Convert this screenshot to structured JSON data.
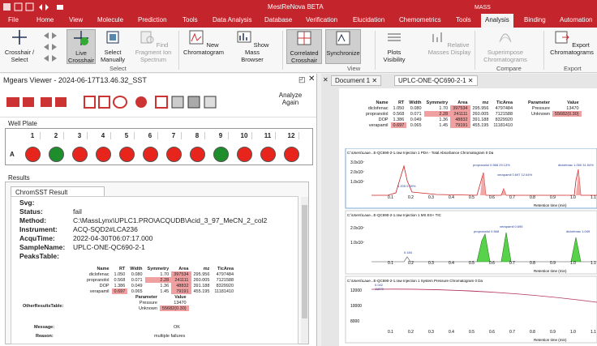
{
  "app": {
    "title": "MestReNova BETA",
    "context_tab": "MASS"
  },
  "menu": [
    "File",
    "Home",
    "View",
    "Molecule",
    "Prediction",
    "Tools",
    "Data Analysis",
    "Database",
    "Verification",
    "Elucidation",
    "Chemometrics",
    "Tools",
    "Analysis",
    "Binding",
    "Automation"
  ],
  "ribbon": {
    "buttons": [
      "Crosshair / Select",
      "Live Crosshair",
      "Select Manually",
      "Find Fragment Ion Spectrum",
      "New Chromatogram",
      "Show Mass Browser",
      "Correlated Crosshair",
      "Synchronize",
      "Plots Visibility",
      "Relative Masses Display",
      "Superimpose Chromatograms",
      "Export Chromatograms"
    ],
    "groups": [
      "Select",
      "View",
      "Compare",
      "Export"
    ]
  },
  "viewer": {
    "title": "Mgears Viewer - 2024-06-17T13.46.32_SST",
    "analyze_again": "Analyze Again",
    "well_plate_label": "Well Plate",
    "results_label": "Results",
    "result_tab": "ChromSST Result"
  },
  "plate": {
    "row": "A",
    "cols": [
      "1",
      "2",
      "3",
      "4",
      "5",
      "6",
      "7",
      "8",
      "9",
      "10",
      "11",
      "12"
    ],
    "wells": [
      "red",
      "green",
      "red",
      "red",
      "red",
      "red",
      "red",
      "red",
      "green",
      "red",
      "red",
      "red"
    ]
  },
  "result": {
    "labels": [
      "Svg:",
      "Status:",
      "Method:",
      "Instrument:",
      "AcquTime:",
      "SampleName:",
      "PeaksTable:"
    ],
    "values": [
      "",
      "fail",
      "C:\\MassLynx\\UPLC1.PRO\\ACQUDB\\Acid_3_97_MeCN_2_col2",
      "ACQ-SQD2#LCA236",
      "2022-04-30T06:07:17.000",
      "UPLC-ONE-QC690-2-1",
      ""
    ],
    "other_label": "OtherResultsTable:",
    "message_label": "Message:",
    "message": "OK",
    "reason_label": "Reason:",
    "reason": "multiple failures"
  },
  "peaks_table": {
    "headers": [
      "Name",
      "RT",
      "Width",
      "Symmetry",
      "Area",
      "mz",
      "TicArea"
    ],
    "rows": [
      [
        "diclofenac",
        "1.050",
        "0.080",
        "1.70",
        "397534",
        "295.956",
        "4797484"
      ],
      [
        "propranolol",
        "0.568",
        "0.071",
        "2.28",
        "241111",
        "260.005",
        "7121588"
      ],
      [
        "DOP",
        "1.386",
        "0.049",
        "1.36",
        "48832",
        "391.188",
        "8329920"
      ],
      [
        "verapamil",
        "0.697",
        "0.065",
        "1.45",
        "79191",
        "455.195",
        "11181410"
      ]
    ]
  },
  "other_table": {
    "headers": [
      "Parameter",
      "Value"
    ],
    "rows": [
      [
        "Pressure",
        "13470"
      ],
      [
        "Unknown",
        "55682(0.30)"
      ]
    ]
  },
  "documents": {
    "tab1": "Document 1",
    "tab2": "UPLC-ONE-QC690-2-1"
  },
  "plots": [
    {
      "title": "C:\\Users\\Laue...E-QC690-2-1.raw Injection 1 PDA - Total Absorbance Chromatogram 0 Da",
      "xlabel": "Retention time (min)"
    },
    {
      "title": "C:\\Users\\Laue...E-QC690-2-1.raw Injection 1 MS ES+ TIC",
      "xlabel": "Retention time (min)"
    },
    {
      "title": "C:\\Users\\Laue...E-QC690-2-1.raw Injection 1 System Pressure Chromatogram 0 Da",
      "xlabel": "Retention time (min)"
    }
  ],
  "chart_data": [
    {
      "type": "line",
      "x_ticks": [
        "0.1",
        "0.2",
        "0.3",
        "0.4",
        "0.5",
        "0.6",
        "0.7",
        "0.8",
        "0.9",
        "1.0",
        "1.1"
      ],
      "y_ticks": [
        "1.0x10⁷",
        "2.0x10⁷",
        "3.0x10⁷"
      ],
      "annotations": [
        "propranolol 0.568 29.13%",
        "verapamil 0.697 12.64%",
        "diclofenac 1.050 31.54%",
        "0.205 0.69%"
      ]
    },
    {
      "type": "line",
      "x_ticks": [
        "0.1",
        "0.2",
        "0.3",
        "0.4",
        "0.5",
        "0.6",
        "0.7",
        "0.8",
        "0.9",
        "1.0",
        "1.1"
      ],
      "y_ticks": [
        "1.0x10⁷",
        "2.0x10⁷"
      ],
      "annotations": [
        "propranolol 0.568",
        "verapamil 0.695",
        "diclofenac 1.049",
        "0.184"
      ]
    },
    {
      "type": "line",
      "x_ticks": [
        "0.1",
        "0.2",
        "0.3",
        "0.4",
        "0.5",
        "0.6",
        "0.7",
        "0.8",
        "0.9",
        "1.0",
        "1.1"
      ],
      "y_ticks": [
        "8000",
        "10000",
        "12000"
      ],
      "annotations": [
        "0.042",
        "11870"
      ]
    }
  ]
}
